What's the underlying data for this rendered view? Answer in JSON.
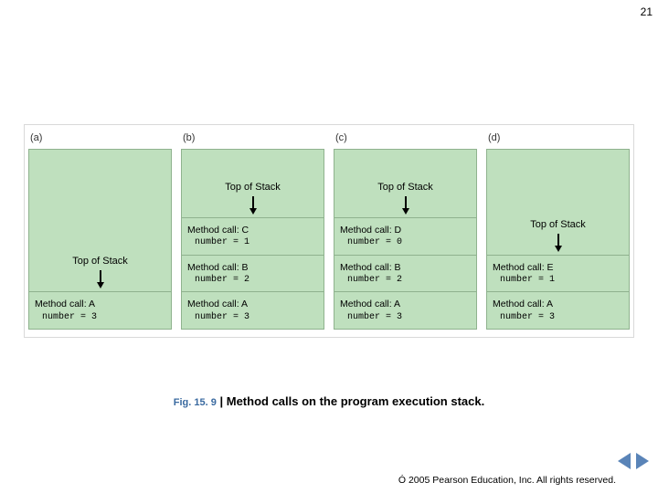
{
  "page_number": "21",
  "figure": {
    "panels": [
      {
        "label": "(a)",
        "top_label": "Top of Stack",
        "frames": [
          {
            "line1": "Method call: A",
            "line2": "number = 3"
          }
        ]
      },
      {
        "label": "(b)",
        "top_label": "Top of Stack",
        "frames": [
          {
            "line1": "Method call: C",
            "line2": "number = 1"
          },
          {
            "line1": "Method call: B",
            "line2": "number = 2"
          },
          {
            "line1": "Method call: A",
            "line2": "number = 3"
          }
        ]
      },
      {
        "label": "(c)",
        "top_label": "Top of Stack",
        "frames": [
          {
            "line1": "Method call: D",
            "line2": "number = 0"
          },
          {
            "line1": "Method call: B",
            "line2": "number = 2"
          },
          {
            "line1": "Method call: A",
            "line2": "number = 3"
          }
        ]
      },
      {
        "label": "(d)",
        "top_label": "Top of Stack",
        "frames": [
          {
            "line1": "Method call: E",
            "line2": "number = 1"
          },
          {
            "line1": "Method call: A",
            "line2": "number = 3"
          }
        ]
      }
    ]
  },
  "caption": {
    "fignum": "Fig. 15. 9",
    "separator": "|",
    "text": "Method calls on the program execution stack."
  },
  "copyright": "Ó 2005 Pearson Education, Inc.  All rights reserved.",
  "colors": {
    "stack_fill": "#bfe0be",
    "stack_border": "#8fb28e",
    "link": "#3a6aa0",
    "nav": "#5a84b8"
  }
}
